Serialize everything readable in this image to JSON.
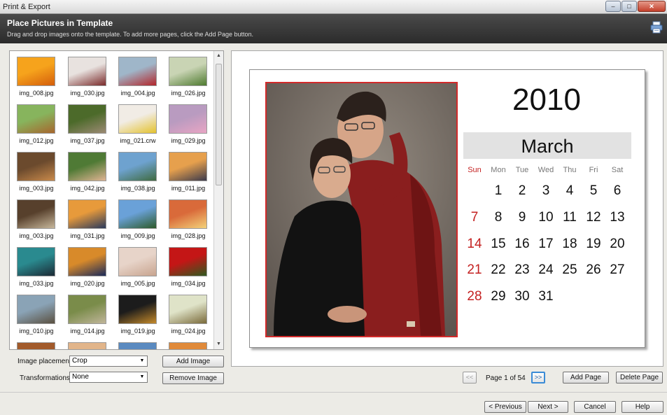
{
  "window": {
    "title": "Print & Export",
    "controls": [
      "minimize-icon",
      "maximize-icon",
      "close-icon"
    ]
  },
  "header": {
    "title": "Place Pictures in Template",
    "subtitle": "Drag and drop images onto the template. To add more pages, click the Add Page button.",
    "icon": "printer-icon"
  },
  "thumbnails": [
    {
      "name": "img_008.jpg",
      "colors": [
        "#f6a31c",
        "#d45e0b"
      ]
    },
    {
      "name": "img_030.jpg",
      "colors": [
        "#e8e2df",
        "#7a2a2a"
      ]
    },
    {
      "name": "img_004.jpg",
      "colors": [
        "#9fb6c9",
        "#b3262b"
      ]
    },
    {
      "name": "img_026.jpg",
      "colors": [
        "#c9d4b4",
        "#4e7a2f"
      ]
    },
    {
      "name": "img_012.jpg",
      "colors": [
        "#87b45d",
        "#a7662d"
      ]
    },
    {
      "name": "img_037.jpg",
      "colors": [
        "#4c6a2a",
        "#9c8a74"
      ]
    },
    {
      "name": "img_021.crw",
      "colors": [
        "#f1ece5",
        "#e4c22e"
      ]
    },
    {
      "name": "img_029.jpg",
      "colors": [
        "#b99bc0",
        "#e8a5c4"
      ]
    },
    {
      "name": "img_003.jpg",
      "colors": [
        "#6b4a2d",
        "#c98a4b"
      ]
    },
    {
      "name": "img_042.jpg",
      "colors": [
        "#4f7a35",
        "#e0b493"
      ]
    },
    {
      "name": "img_038.jpg",
      "colors": [
        "#6ea2cf",
        "#3f6a3f"
      ]
    },
    {
      "name": "img_011.jpg",
      "colors": [
        "#e6a04d",
        "#3b3a4c"
      ]
    },
    {
      "name": "img_003.jpg",
      "colors": [
        "#57402c",
        "#c7b79b"
      ]
    },
    {
      "name": "img_031.jpg",
      "colors": [
        "#e79a3b",
        "#2a3a5c"
      ]
    },
    {
      "name": "img_009.jpg",
      "colors": [
        "#6aa1d8",
        "#2d5a2a"
      ]
    },
    {
      "name": "img_028.jpg",
      "colors": [
        "#d96a3a",
        "#f3d27a"
      ]
    },
    {
      "name": "img_033.jpg",
      "colors": [
        "#2a8a8f",
        "#1c2a35"
      ]
    },
    {
      "name": "img_020.jpg",
      "colors": [
        "#d88a2a",
        "#1a2a5a"
      ]
    },
    {
      "name": "img_005.jpg",
      "colors": [
        "#e7d4c9",
        "#c8a48f"
      ]
    },
    {
      "name": "img_034.jpg",
      "colors": [
        "#c41616",
        "#2f5a1f"
      ]
    },
    {
      "name": "img_010.jpg",
      "colors": [
        "#8aa3b6",
        "#5a5040"
      ]
    },
    {
      "name": "img_014.jpg",
      "colors": [
        "#7a8c4a",
        "#c0b59a"
      ]
    },
    {
      "name": "img_019.jpg",
      "colors": [
        "#1c1c1c",
        "#c58a2a"
      ]
    },
    {
      "name": "img_024.jpg",
      "colors": [
        "#dfe3c8",
        "#7a6a3a"
      ]
    },
    {
      "name": "",
      "colors": [
        "#a25a2a",
        "#7a3a1a"
      ]
    },
    {
      "name": "",
      "colors": [
        "#e2b58a",
        "#c47a4a"
      ]
    },
    {
      "name": "",
      "colors": [
        "#5a8ac0",
        "#3a6a9a"
      ]
    },
    {
      "name": "",
      "colors": [
        "#e08a3a",
        "#b45a1a"
      ]
    }
  ],
  "controls": {
    "placement_label": "Image placement:",
    "placement_value": "Crop",
    "transform_label": "Transformations:",
    "transform_value": "None",
    "add_image": "Add Image",
    "remove_image": "Remove Image"
  },
  "calendar": {
    "year": "2010",
    "month": "March",
    "days_of_week": [
      "Sun",
      "Mon",
      "Tue",
      "Wed",
      "Thu",
      "Fri",
      "Sat"
    ],
    "weeks": [
      [
        "",
        "1",
        "2",
        "3",
        "4",
        "5",
        "6"
      ],
      [
        "7",
        "8",
        "9",
        "10",
        "11",
        "12",
        "13"
      ],
      [
        "14",
        "15",
        "16",
        "17",
        "18",
        "19",
        "20"
      ],
      [
        "21",
        "22",
        "23",
        "24",
        "25",
        "26",
        "27"
      ],
      [
        "28",
        "29",
        "30",
        "31",
        "",
        "",
        ""
      ]
    ],
    "accent_color": "#c42121"
  },
  "pager": {
    "prev": "<<",
    "next": ">>",
    "info": "Page 1 of 54",
    "add_page": "Add Page",
    "delete_page": "Delete Page"
  },
  "footer": {
    "previous": "< Previous",
    "next": "Next >",
    "cancel": "Cancel",
    "help": "Help"
  }
}
